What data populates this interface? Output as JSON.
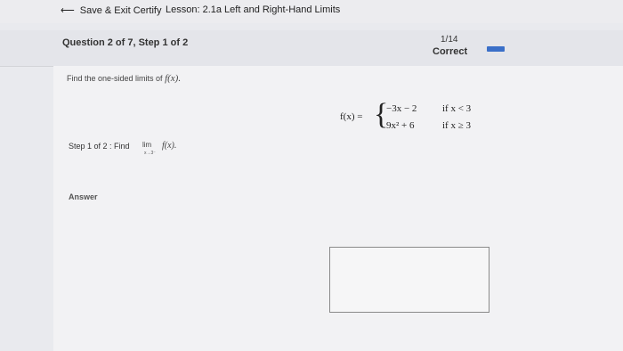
{
  "topbar": {
    "back_label": "Save & Exit Certify",
    "lesson_title": "Lesson: 2.1a Left and Right-Hand Limits"
  },
  "question": {
    "title": "Question 2 of 7, Step 1 of 2",
    "progress_count": "1/14",
    "progress_status": "Correct",
    "progress_color": "#3a6fc8"
  },
  "problem": {
    "prompt_text": "Find the one-sided limits of ",
    "prompt_math": "f(x).",
    "function_lhs": "f(x) =",
    "case1_expr": "−3x − 2",
    "case1_cond": "if x < 3",
    "case2_expr": "9x² + 6",
    "case2_cond": "if x ≥ 3"
  },
  "step": {
    "label": "Step 1 of 2 :  Find",
    "lim_word": "lim",
    "lim_sub": "x→3⁻",
    "lim_fn": "f(x)."
  },
  "answer": {
    "label": "Answer"
  }
}
